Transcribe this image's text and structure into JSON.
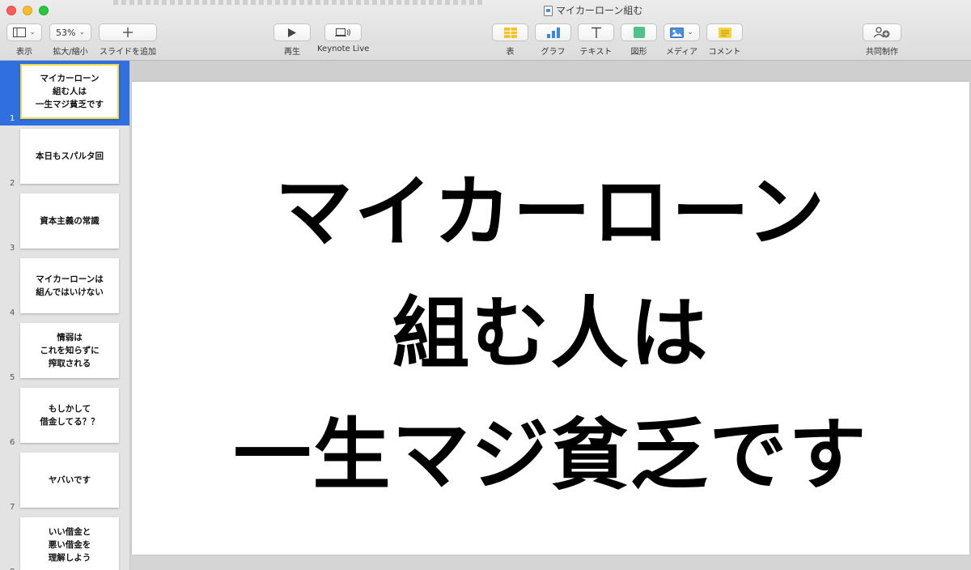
{
  "window": {
    "title": "マイカーローン組む"
  },
  "toolbar": {
    "view_label": "表示",
    "zoom_value": "53%",
    "zoom_label": "拡大/縮小",
    "add_slide_label": "スライドを追加",
    "play_label": "再生",
    "keynote_live_label": "Keynote Live",
    "table_label": "表",
    "chart_label": "グラフ",
    "text_label": "テキスト",
    "shape_label": "図形",
    "media_label": "メディア",
    "comment_label": "コメント",
    "collaborate_label": "共同制作"
  },
  "colors": {
    "selection": "#2f6fe0",
    "selected_thumb_border": "#f2d84b",
    "table_icon": "#f5c228",
    "chart_icon": "#3d86e0",
    "shape_icon": "#4cc38a",
    "media_icon": "#4a90d9",
    "comment_icon": "#f7d23c"
  },
  "slides": [
    {
      "number": "1",
      "text": "マイカーローン\n組む人は\n一生マジ貧乏です",
      "selected": true
    },
    {
      "number": "2",
      "text": "本日もスパルタ回"
    },
    {
      "number": "3",
      "text": "資本主義の常識"
    },
    {
      "number": "4",
      "text": "マイカーローンは\n組んではいけない"
    },
    {
      "number": "5",
      "text": "情弱は\nこれを知らずに\n搾取される"
    },
    {
      "number": "6",
      "text": "もしかして\n借金してる？？"
    },
    {
      "number": "7",
      "text": "ヤバいです"
    },
    {
      "number": "8",
      "text": "いい借金と\n悪い借金を\n理解しよう"
    }
  ],
  "current_slide": {
    "title": "マイカーローン\n組む人は\n一生マジ貧乏です"
  }
}
